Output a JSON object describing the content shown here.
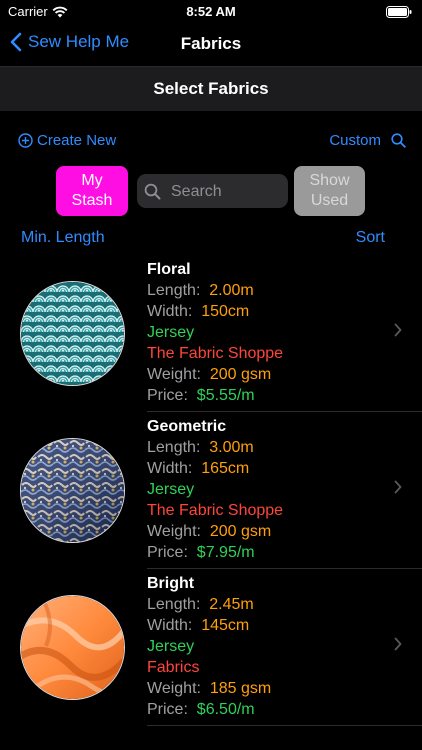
{
  "status": {
    "carrier": "Carrier",
    "time": "8:52 AM"
  },
  "nav": {
    "back_label": "Sew Help Me",
    "title": "Fabrics"
  },
  "header": {
    "title": "Select Fabrics"
  },
  "toolbar": {
    "create_new": "Create New",
    "custom": "Custom"
  },
  "filters": {
    "my_stash_line1": "My",
    "my_stash_line2": "Stash",
    "search_placeholder": "Search",
    "show_used_line1": "Show",
    "show_used_line2": "Used"
  },
  "sort_bar": {
    "min_length": "Min. Length",
    "sort": "Sort"
  },
  "labels": {
    "length": "Length:",
    "width": "Width:",
    "weight": "Weight:",
    "price": "Price:"
  },
  "fabrics": [
    {
      "name": "Floral",
      "length": "2.00m",
      "width": "150cm",
      "type": "Jersey",
      "store": "The Fabric Shoppe",
      "weight": "200 gsm",
      "price": "$5.55/m",
      "swatch": "teal-scale-pattern-icon"
    },
    {
      "name": "Geometric",
      "length": "3.00m",
      "width": "165cm",
      "type": "Jersey",
      "store": "The Fabric Shoppe",
      "weight": "200 gsm",
      "price": "$7.95/m",
      "swatch": "navy-geometric-pattern-icon"
    },
    {
      "name": "Bright",
      "length": "2.45m",
      "width": "145cm",
      "type": "Jersey",
      "store": "Fabrics",
      "weight": "185 gsm",
      "price": "$6.50/m",
      "swatch": "orange-draped-fabric-icon"
    }
  ],
  "colors": {
    "accent": "#2f8cff",
    "stash": "#ff0ee4",
    "orange": "#ff9f0a",
    "green": "#30d158",
    "red": "#ff453a"
  }
}
